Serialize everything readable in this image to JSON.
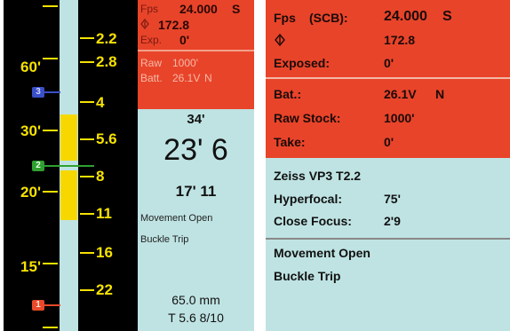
{
  "left": {
    "scale_left_labels": [
      "60'",
      "30'",
      "20'",
      "15'"
    ],
    "scale_right_labels": [
      "2.2",
      "2.8",
      "4",
      "5.6",
      "8",
      "11",
      "16",
      "22"
    ],
    "markers": [
      "3",
      "2",
      "1"
    ],
    "red": {
      "fps_label": "Fps",
      "fps_value": "24.000",
      "fps_unit": "S",
      "shutter_icon": "shutter-angle-icon",
      "shutter_value": "172.8",
      "exp_label": "Exp.",
      "exp_value": "0'",
      "raw_label": "Raw",
      "raw_value": "1000'",
      "batt_label": "Batt.",
      "batt_value": "26.1V",
      "batt_unit": "N"
    },
    "focus": {
      "far": "34'",
      "main": "23' 6",
      "near": "17' 11",
      "movement": "Movement Open",
      "buckle": "Buckle Trip",
      "focal": "65.0  mm",
      "aperture": "T  5.6  8/10"
    },
    "colors": {
      "red": "#e8442a",
      "cyan": "#bfe3e3",
      "yellow": "#f6d800"
    }
  },
  "right": {
    "fps_label": "Fps",
    "fps_sub": "(SCB):",
    "fps_value": "24.000",
    "fps_unit": "S",
    "shutter_icon": "shutter-angle-icon",
    "shutter_value": "172.8",
    "exposed_label": "Exposed:",
    "exposed_value": "0'",
    "bat_label": "Bat.:",
    "bat_value": "26.1V",
    "bat_unit": "N",
    "raw_label": "Raw Stock:",
    "raw_value": "1000'",
    "take_label": "Take:",
    "take_value": "0'",
    "lens": "Zeiss  VP3  T2.2",
    "hyper_label": "Hyperfocal:",
    "hyper_value": "75'",
    "close_label": "Close Focus:",
    "close_value": "2'9",
    "movement": "Movement  Open",
    "buckle": "Buckle  Trip"
  }
}
